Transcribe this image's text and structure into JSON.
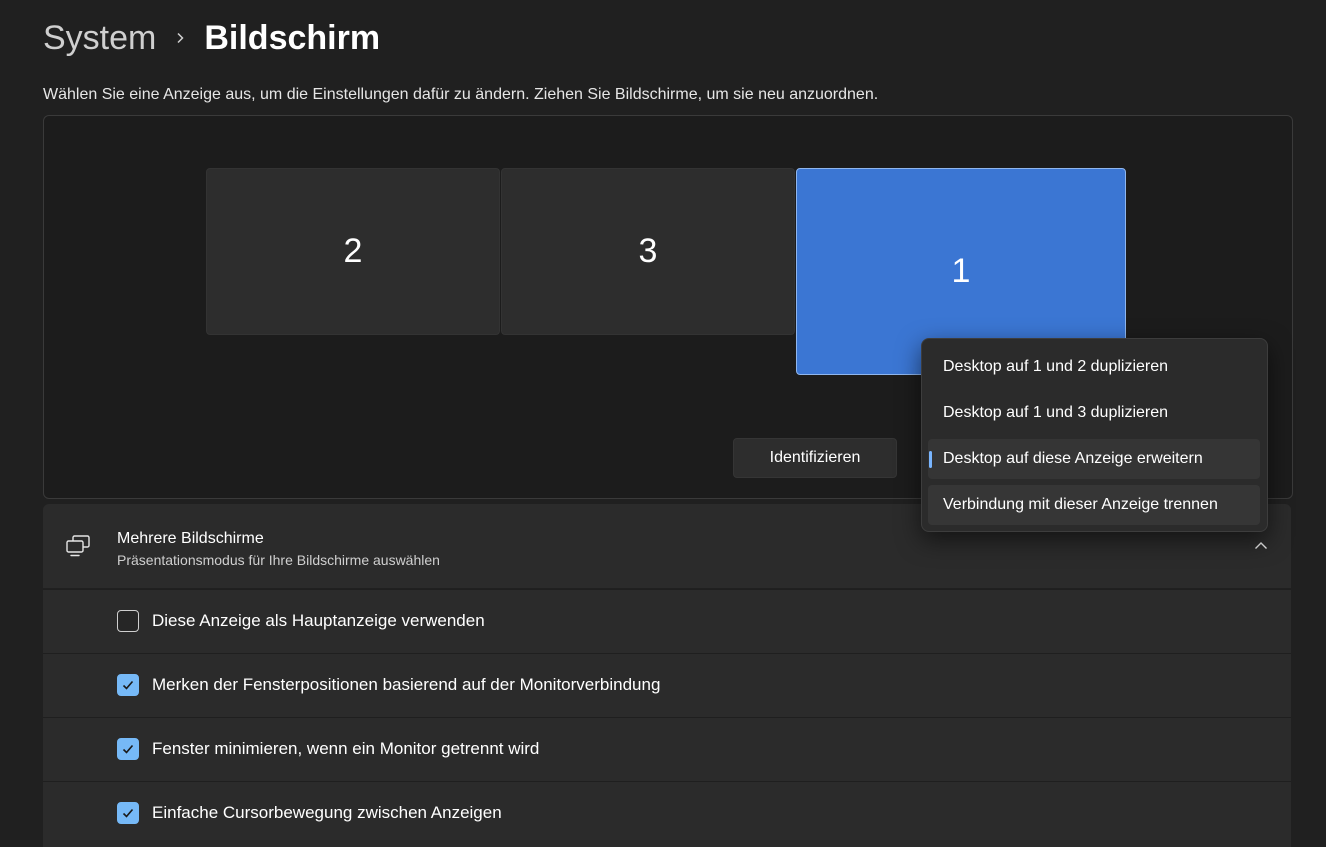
{
  "breadcrumb": {
    "parent": "System",
    "current": "Bildschirm"
  },
  "description": "Wählen Sie eine Anzeige aus, um die Einstellungen dafür zu ändern. Ziehen Sie Bildschirme, um sie neu anzuordnen.",
  "displays": [
    {
      "label": "2",
      "selected": false
    },
    {
      "label": "3",
      "selected": false
    },
    {
      "label": "1",
      "selected": true
    }
  ],
  "identify_label": "Identifizieren",
  "flyout": {
    "items": [
      {
        "label": "Desktop auf 1 und 2 duplizieren"
      },
      {
        "label": "Desktop auf 1 und 3 duplizieren"
      },
      {
        "label": "Desktop auf diese Anzeige erweitern",
        "selected": true
      },
      {
        "label": "Verbindung mit dieser Anzeige trennen"
      }
    ]
  },
  "multiple_displays": {
    "title": "Mehrere Bildschirme",
    "subtitle": "Präsentationsmodus für Ihre Bildschirme auswählen",
    "icon": "multiple-monitors-icon",
    "expanded": true
  },
  "options": [
    {
      "label": "Diese Anzeige als Hauptanzeige verwenden",
      "checked": false
    },
    {
      "label": "Merken der Fensterpositionen basierend auf der Monitorverbindung",
      "checked": true
    },
    {
      "label": "Fenster minimieren, wenn ein Monitor getrennt wird",
      "checked": true
    },
    {
      "label": "Einfache Cursorbewegung zwischen Anzeigen",
      "checked": true
    }
  ],
  "colors": {
    "accent": "#3b76d3",
    "checkbox": "#76b9f7",
    "selection_indicator": "#79b5ff",
    "background": "#202020"
  }
}
